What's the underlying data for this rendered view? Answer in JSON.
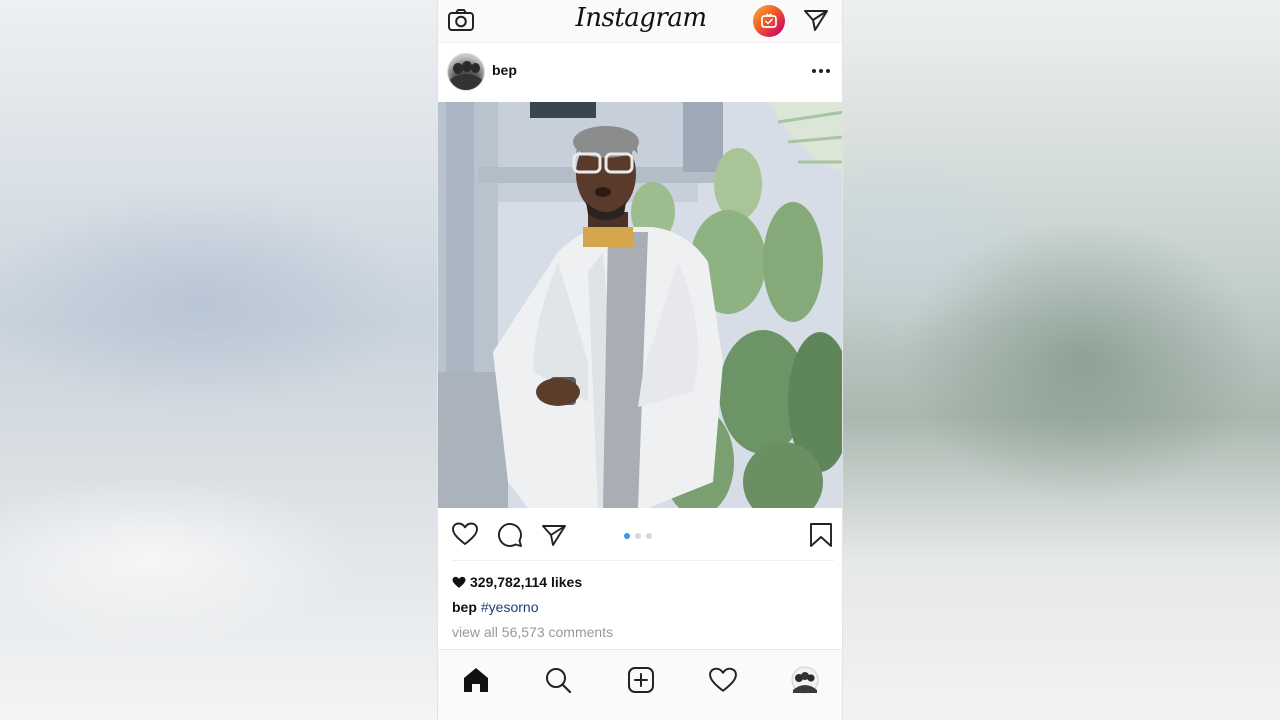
{
  "app": {
    "logo_text": "Instagram",
    "icons": {
      "camera": "camera-icon",
      "igtv": "igtv-icon",
      "direct": "direct-message-icon"
    },
    "accent_colors": {
      "link": "#1d3f73",
      "active_dot": "#3897f0",
      "igtv_gradient": [
        "#fbb03b",
        "#f15a24",
        "#d4145a",
        "#9e005d"
      ]
    }
  },
  "post": {
    "username": "bep",
    "more_icon": "more-options-icon",
    "carousel": {
      "count": 3,
      "active_index": 0
    },
    "likes_text": "329,782,114 likes",
    "caption_user": "bep",
    "caption_tag": "#yesorno",
    "comments_text": "view all 56,573 comments",
    "actions": [
      "like-icon",
      "comment-icon",
      "share-icon",
      "save-icon"
    ]
  },
  "bottom_nav": [
    "home-icon",
    "search-icon",
    "new-post-icon",
    "activity-icon",
    "profile-avatar"
  ]
}
